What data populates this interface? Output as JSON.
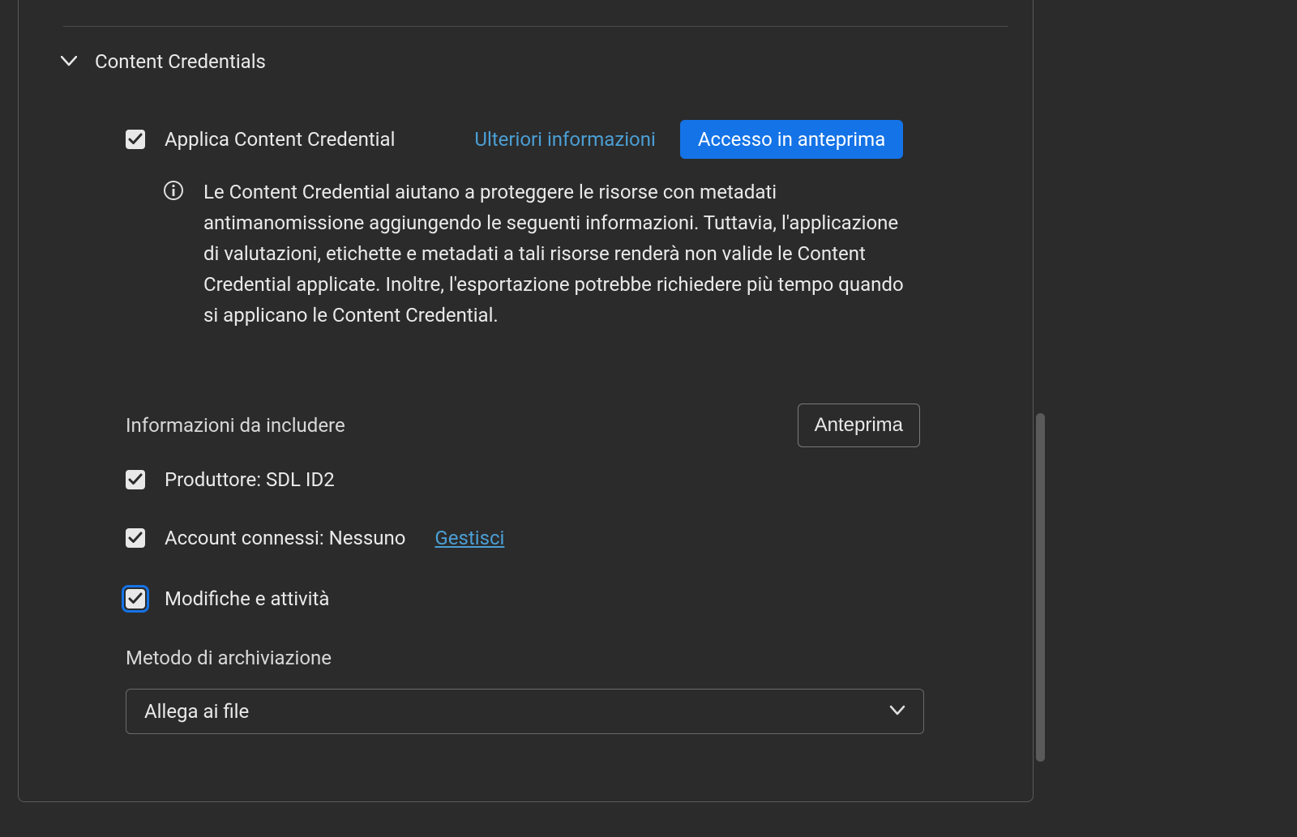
{
  "section": {
    "title": "Content Credentials"
  },
  "apply": {
    "label": "Applica Content Credential",
    "checked": true,
    "learn_more": "Ulteriori informazioni",
    "preview_access": "Accesso in anteprima"
  },
  "info_text": "Le Content Credential aiutano a proteggere le risorse con metadati antimanomissione aggiungendo le seguenti informazioni. Tuttavia, l'applicazione di valutazioni, etichette e metadati a tali risorse renderà non valide le Content Credential applicate. Inoltre, l'esportazione potrebbe richiedere più tempo quando si applicano le Content Credential.",
  "include": {
    "heading": "Informazioni da includere",
    "preview_button": "Anteprima",
    "producer": {
      "label": "Produttore: SDL ID2",
      "checked": true
    },
    "accounts": {
      "label": "Account connessi: Nessuno",
      "checked": true,
      "manage": "Gestisci"
    },
    "edits": {
      "label": "Modifiche e attività",
      "checked": true
    }
  },
  "storage": {
    "label": "Metodo di archiviazione",
    "value": "Allega ai file"
  }
}
